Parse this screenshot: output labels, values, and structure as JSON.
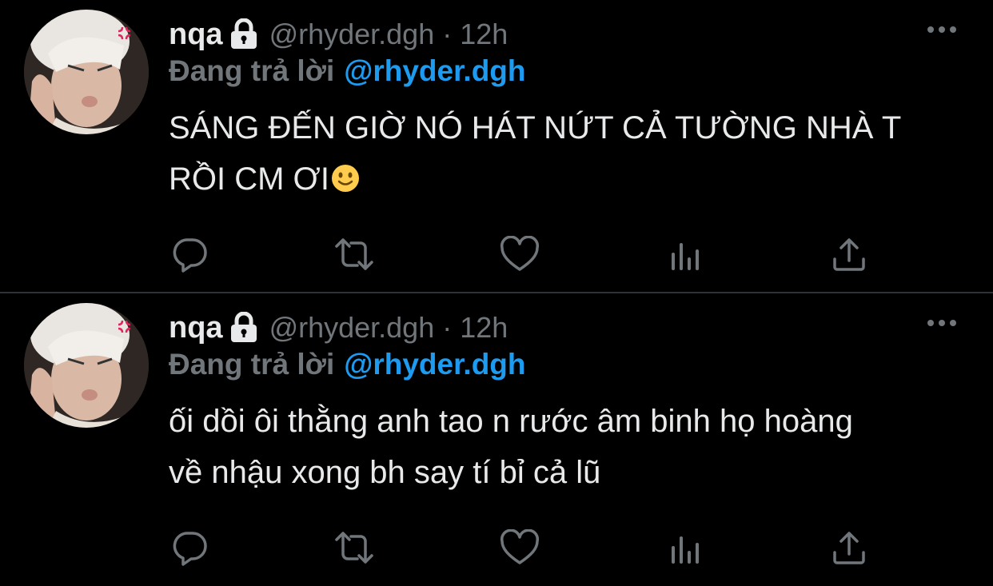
{
  "colors": {
    "background": "#000000",
    "primary_text": "#e7e9ea",
    "secondary_text": "#71767b",
    "accent": "#1d9bf0",
    "divider": "#2f3336"
  },
  "tweets": [
    {
      "name": "nqa",
      "lock_icon": "lock-icon",
      "handle": "@rhyder.dgh",
      "dot": "·",
      "time": "12h",
      "reply_prefix": "Đang trả lời",
      "reply_handle": "@rhyder.dgh",
      "lines": [
        "SÁNG ĐẾN GIỜ NÓ HÁT NỨT CẢ TƯỜNG NHÀ T",
        "RỒI CM ƠI"
      ],
      "emoji": "slightly-smiling-face",
      "actions": [
        "reply-icon",
        "retweet-icon",
        "like-icon",
        "views-icon",
        "share-icon"
      ]
    },
    {
      "name": "nqa",
      "lock_icon": "lock-icon",
      "handle": "@rhyder.dgh",
      "dot": "·",
      "time": "12h",
      "reply_prefix": "Đang trả lời",
      "reply_handle": "@rhyder.dgh",
      "lines": [
        "ối dồi ôi thằng anh tao n rước âm binh họ hoàng",
        "về nhậu xong bh say tí bỉ cả lũ"
      ],
      "actions": [
        "reply-icon",
        "retweet-icon",
        "like-icon",
        "views-icon",
        "share-icon"
      ]
    }
  ]
}
